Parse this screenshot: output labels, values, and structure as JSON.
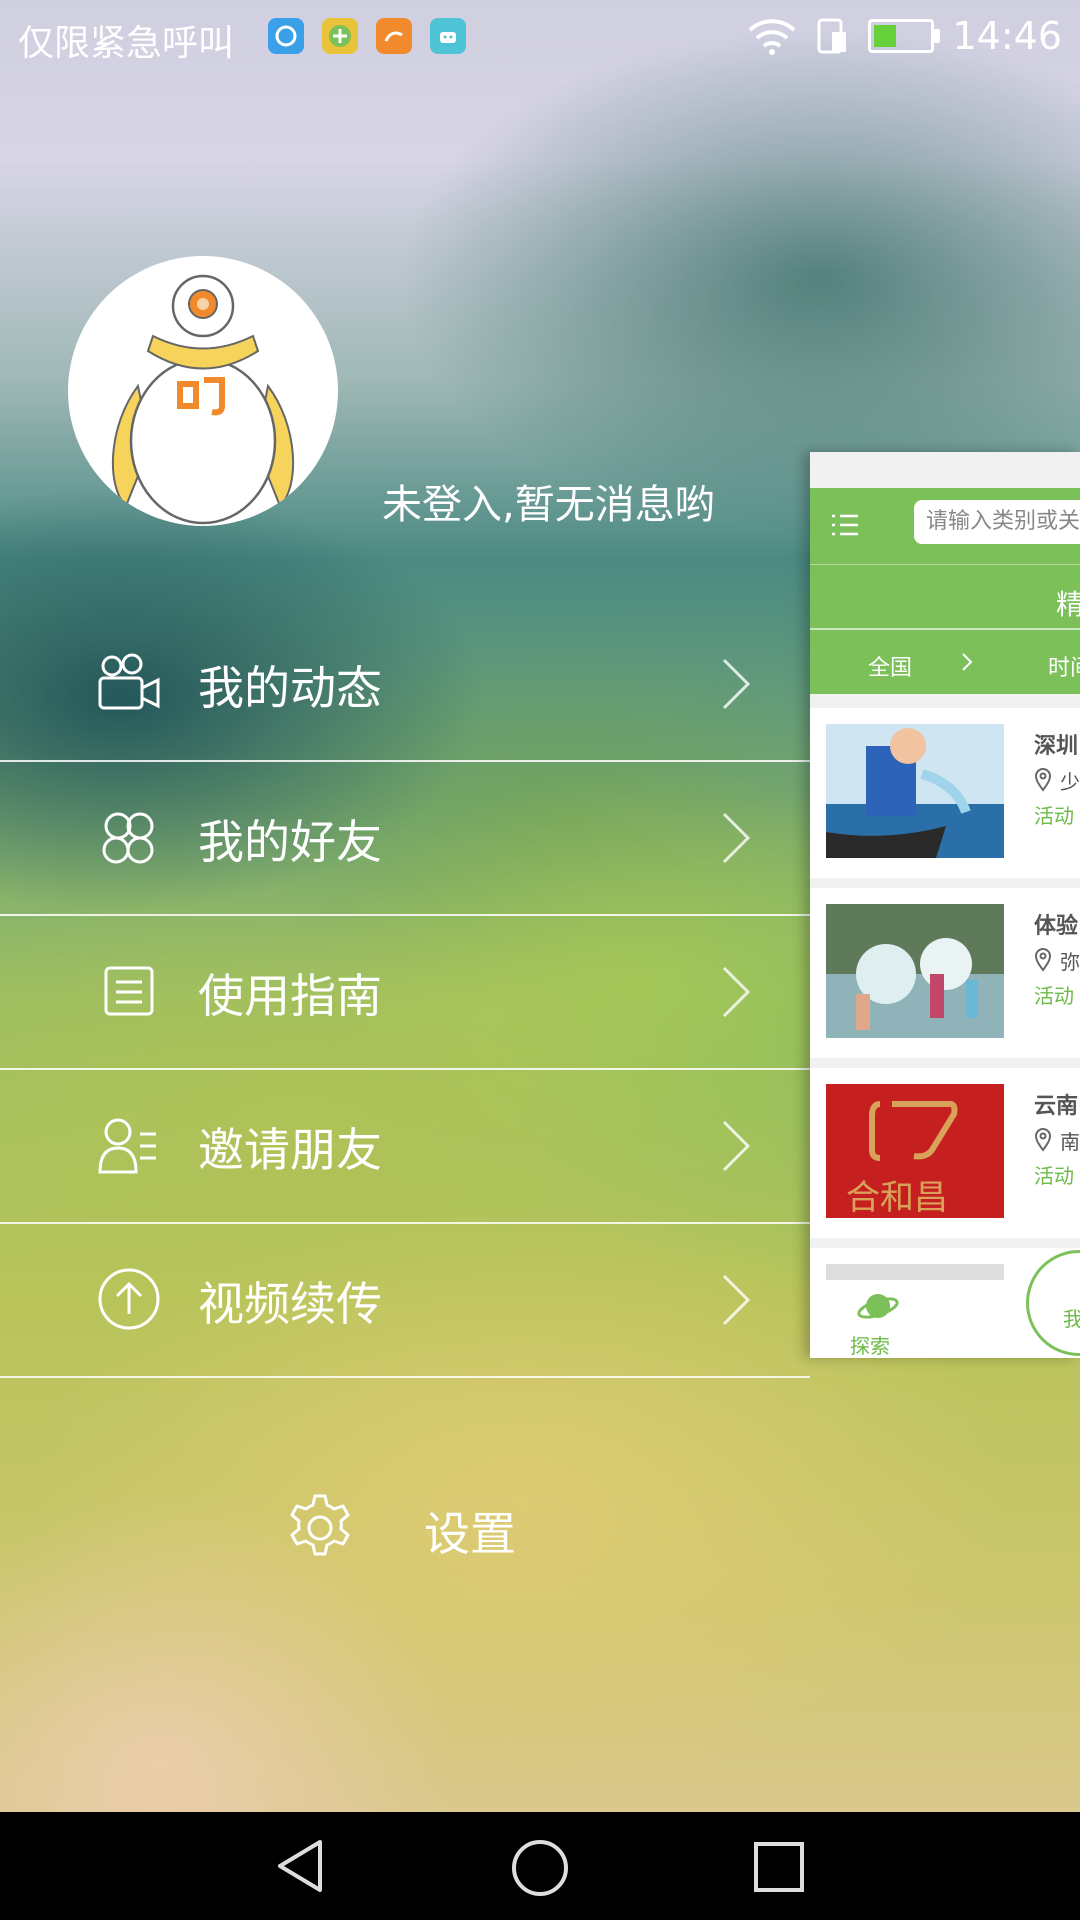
{
  "status_bar": {
    "carrier_text": "仅限紧急呼叫",
    "apps": [
      {
        "icon": "qq-browser-icon",
        "color": "#3aa0e8"
      },
      {
        "icon": "plus-app-icon",
        "color": "#7cc05a"
      },
      {
        "icon": "uc-browser-icon",
        "color": "#f08a2c"
      },
      {
        "icon": "android-icon",
        "color": "#4fc3d6"
      }
    ],
    "time": "14:46"
  },
  "profile": {
    "login_message": "未登入,暂无消息哟"
  },
  "menu": {
    "items": [
      {
        "label": "我的动态",
        "icon": "video-camera-icon"
      },
      {
        "label": "我的好友",
        "icon": "friends-icon"
      },
      {
        "label": "使用指南",
        "icon": "guide-icon"
      },
      {
        "label": "邀请朋友",
        "icon": "invite-icon"
      },
      {
        "label": "视频续传",
        "icon": "upload-icon"
      }
    ]
  },
  "settings": {
    "label": "设置"
  },
  "main_panel": {
    "search_placeholder": "请输入类别或关",
    "tab_label": "精",
    "filter": {
      "region": "全国",
      "time": "时间"
    },
    "list": [
      {
        "title": "深圳",
        "location": "少",
        "activity": "活动"
      },
      {
        "title": "体验",
        "location": "弥",
        "activity": "活动"
      },
      {
        "title": "云南",
        "location": "南",
        "activity": "活动"
      }
    ],
    "thumb3_text": "合和昌",
    "tabbar": {
      "explore": "探索",
      "me": "我"
    }
  },
  "colors": {
    "accent": "#7cc05a",
    "activity_text": "#6bbb46"
  }
}
